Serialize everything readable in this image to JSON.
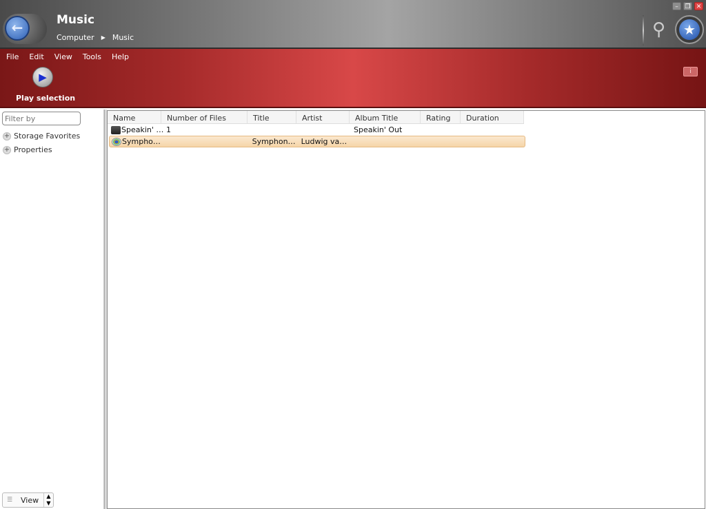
{
  "window": {
    "title": "Music",
    "breadcrumb": [
      "Computer",
      "Music"
    ]
  },
  "menu": [
    "File",
    "Edit",
    "View",
    "Tools",
    "Help"
  ],
  "toolbar": {
    "play_label": "Play selection"
  },
  "sidebar": {
    "filter_placeholder": "Filter by",
    "items": [
      {
        "label": "Storage Favorites"
      },
      {
        "label": "Properties"
      }
    ],
    "view_label": "View"
  },
  "table": {
    "columns": [
      "Name",
      "Number of Files",
      "Title",
      "Artist",
      "Album Title",
      "Rating",
      "Duration"
    ],
    "rows": [
      {
        "name": "Speakin' …",
        "files": "1",
        "title": "",
        "artist": "",
        "album": "Speakin' Out",
        "rating": "",
        "duration": "",
        "icon": "album-icon",
        "selected": false
      },
      {
        "name": "Sympho…",
        "files": "",
        "title": "Symphon…",
        "artist": "Ludwig va…",
        "album": "",
        "rating": "",
        "duration": "",
        "icon": "media-file-icon",
        "selected": true
      }
    ]
  }
}
